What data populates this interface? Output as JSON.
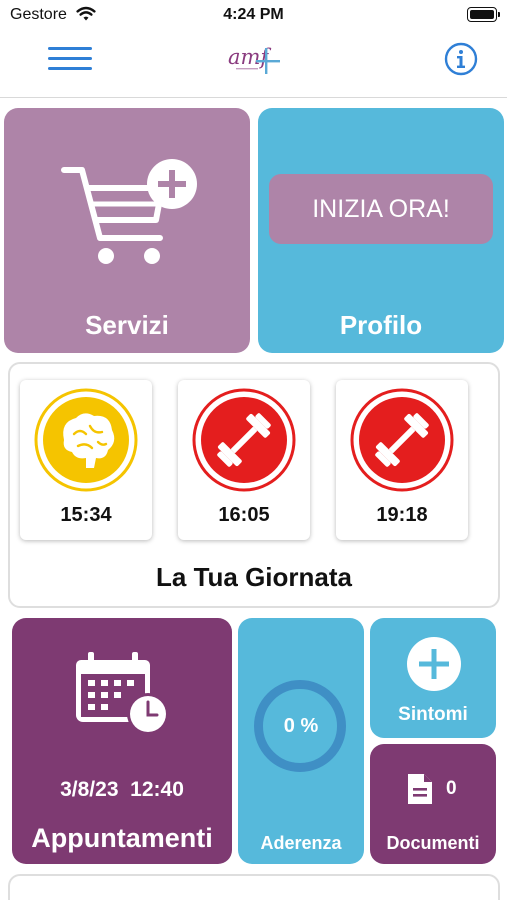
{
  "status_bar": {
    "carrier": "Gestore",
    "time": "4:24 PM"
  },
  "header": {
    "logo_text": "amf"
  },
  "tiles": {
    "servizi": {
      "label": "Servizi"
    },
    "profilo": {
      "label": "Profilo",
      "button_label": "INIZIA ORA!"
    }
  },
  "giornata": {
    "title": "La Tua Giornata",
    "activities": [
      {
        "icon": "brain-icon",
        "time": "15:34"
      },
      {
        "icon": "dumbbell-icon",
        "time": "16:05"
      },
      {
        "icon": "dumbbell-icon",
        "time": "19:18"
      }
    ]
  },
  "appuntamenti": {
    "label": "Appuntamenti",
    "date": "3/8/23  12:40"
  },
  "aderenza": {
    "label": "Aderenza",
    "value": "0 %"
  },
  "sintomi": {
    "label": "Sintomi"
  },
  "documenti": {
    "label": "Documenti",
    "count": "0"
  },
  "colors": {
    "mauve": "#ae84a8",
    "sky": "#56b9db",
    "plum": "#7e3a72",
    "accent_blue": "#2f7fd6",
    "brain_yellow": "#f5c400",
    "workout_red": "#e41e1e"
  }
}
